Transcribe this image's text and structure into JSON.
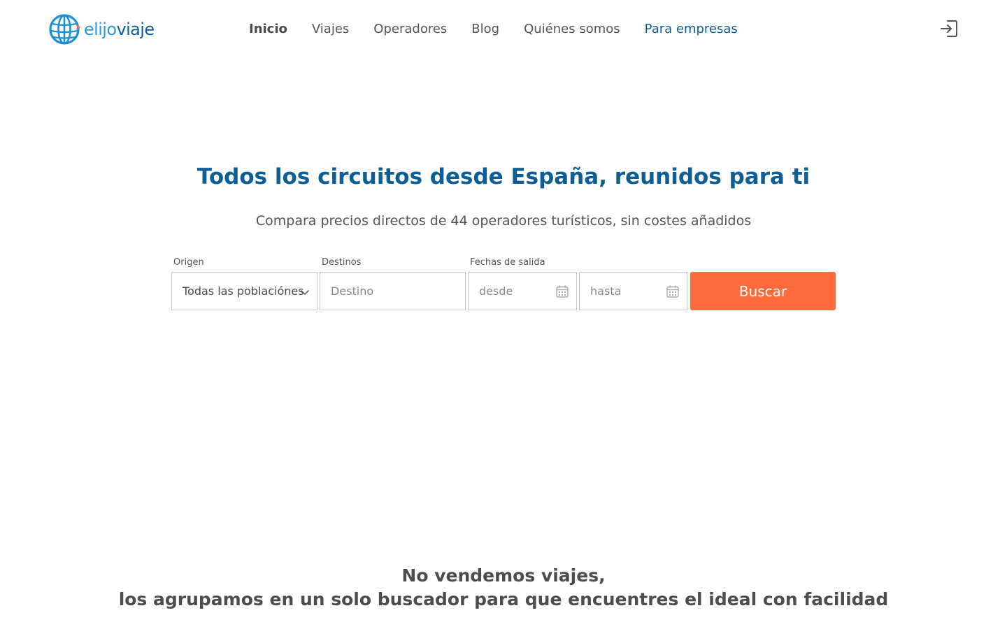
{
  "brand": {
    "name_part_a": "elijo",
    "name_part_b": "viaje",
    "logo_icon": "globe-icon",
    "colors": {
      "primary_blue": "#0d5e95",
      "light_blue": "#2d9ad7",
      "accent_orange": "#ff6b3d"
    }
  },
  "nav": {
    "items": [
      {
        "label": "Inicio",
        "state": "active"
      },
      {
        "label": "Viajes"
      },
      {
        "label": "Operadores"
      },
      {
        "label": "Blog"
      },
      {
        "label": "Quiénes somos"
      },
      {
        "label": "Para empresas"
      }
    ],
    "login_icon": "login-icon"
  },
  "hero": {
    "title": "Todos los circuitos desde España, reunidos para ti",
    "subtitle": "Compara precios directos de 44 operadores turísticos, sin costes añadidos"
  },
  "search": {
    "origin": {
      "label": "Origen",
      "value": "Todas las poblaciónes",
      "icon": "chevron-down-icon"
    },
    "destination": {
      "label": "Destinos",
      "placeholder": "Destino"
    },
    "dates": {
      "label": "Fechas de salida",
      "from_placeholder": "desde",
      "to_placeholder": "hasta",
      "icon": "calendar-icon"
    },
    "submit_label": "Buscar"
  },
  "tagline": {
    "line1": "No vendemos viajes,",
    "line2": "los agrupamos en un solo buscador para que encuentres el ideal con facilidad"
  }
}
